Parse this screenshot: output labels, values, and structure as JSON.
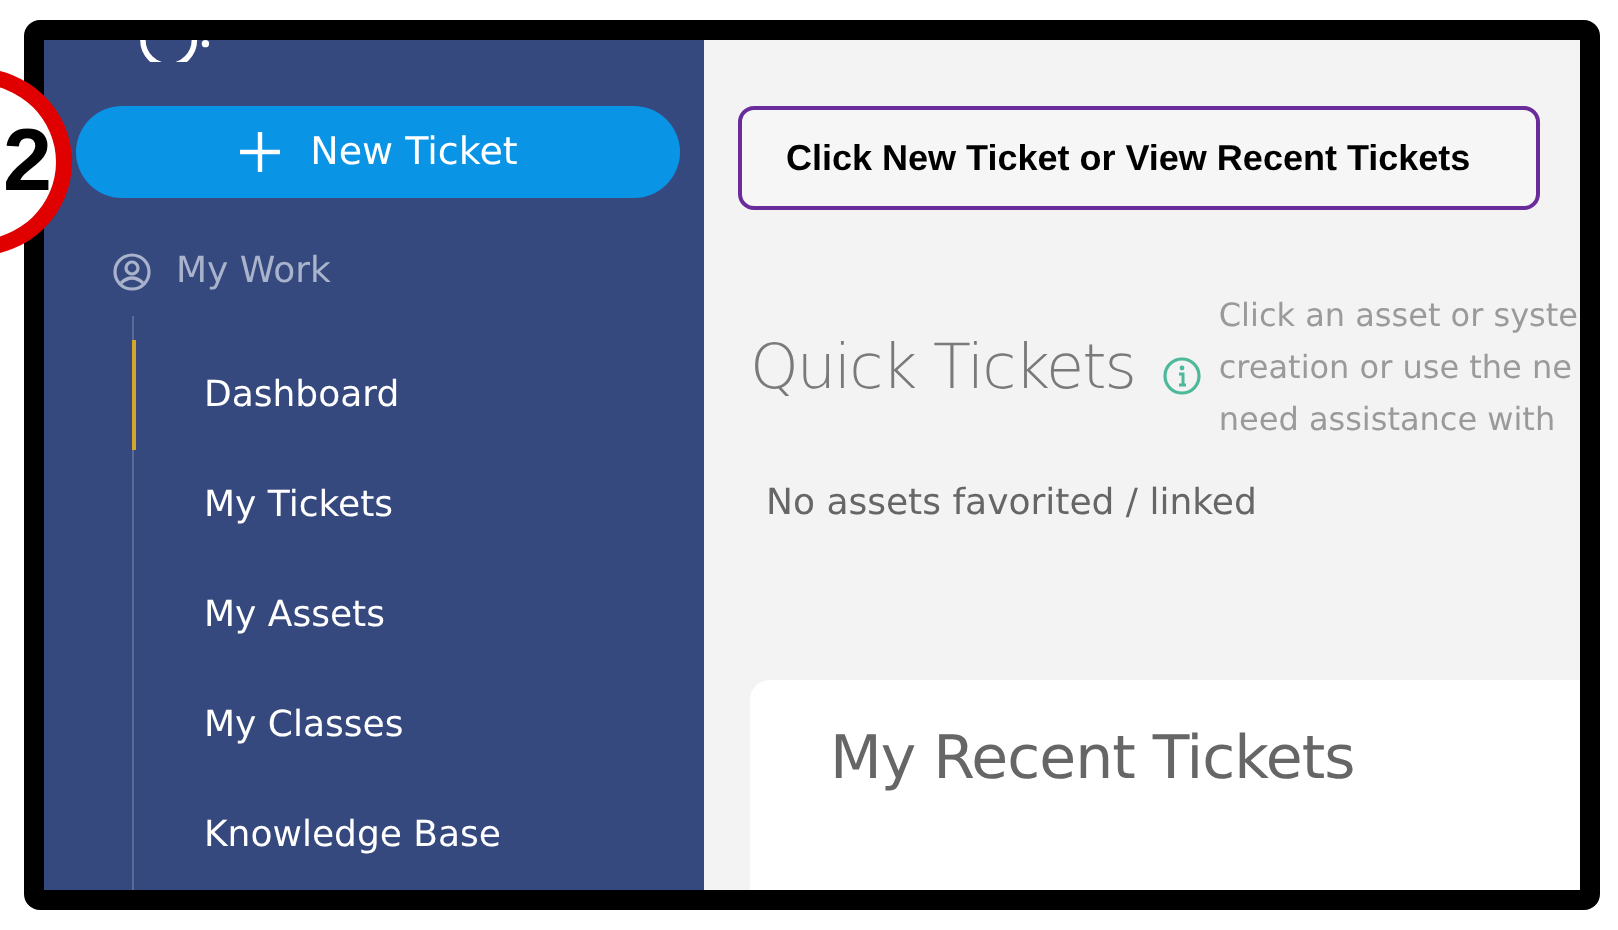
{
  "annotation": {
    "step": "2",
    "callout": "Click New Ticket or View Recent Tickets"
  },
  "sidebar": {
    "new_ticket": "New Ticket",
    "section": "My Work",
    "items": [
      {
        "label": "Dashboard",
        "selected": true
      },
      {
        "label": "My Tickets",
        "selected": false
      },
      {
        "label": "My Assets",
        "selected": false
      },
      {
        "label": "My Classes",
        "selected": false
      },
      {
        "label": "Knowledge Base",
        "selected": false
      }
    ]
  },
  "quick_tickets": {
    "title": "Quick Tickets",
    "description": [
      "Click an asset or syste",
      "creation or use the ne",
      "need assistance with"
    ],
    "empty": "No assets favorited / linked"
  },
  "recent": {
    "title": "My Recent Tickets"
  }
}
